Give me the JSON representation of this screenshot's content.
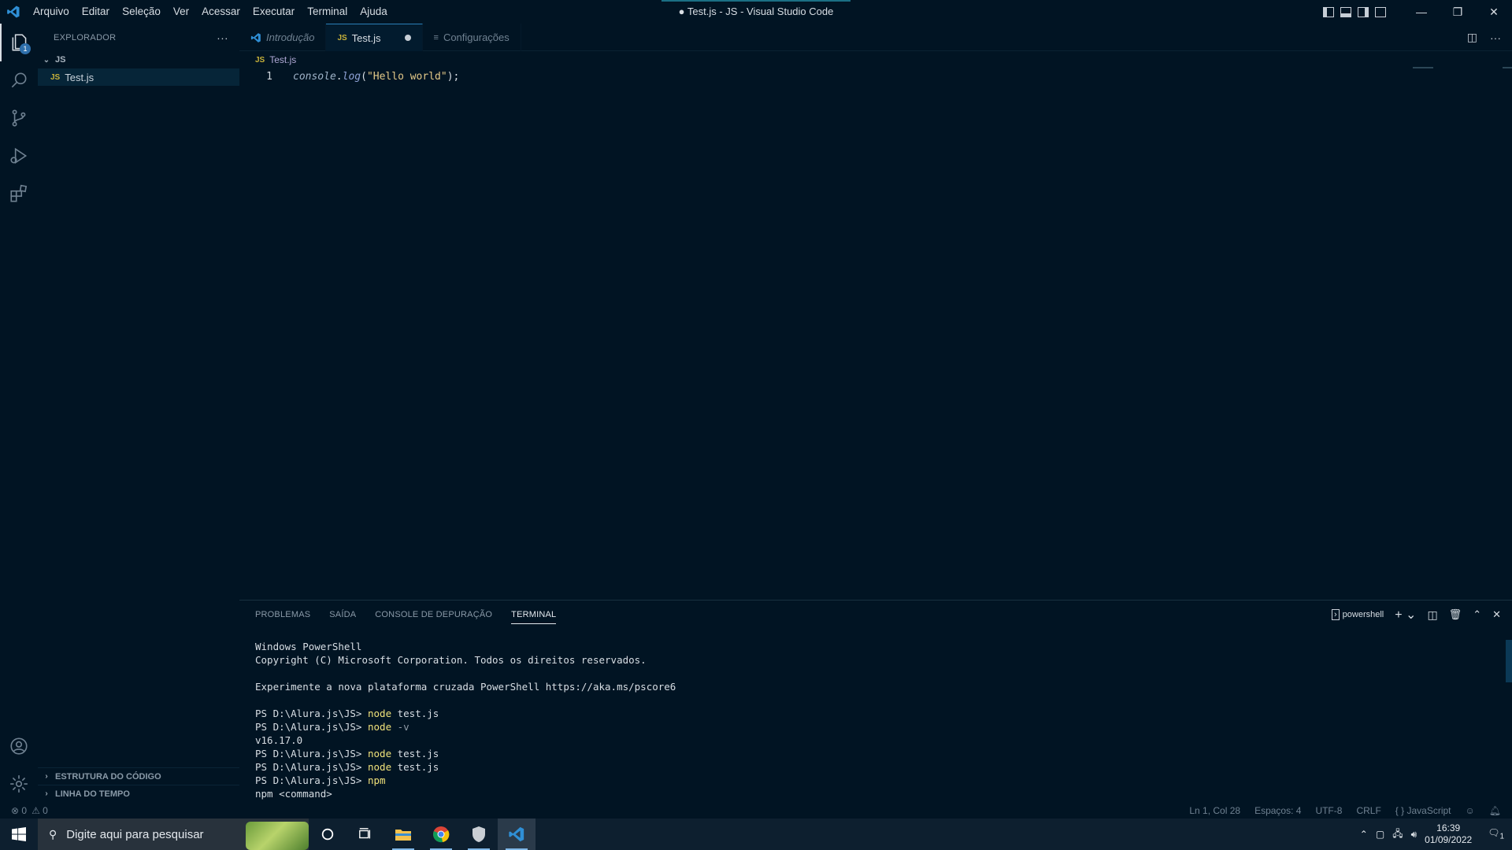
{
  "menu": [
    "Arquivo",
    "Editar",
    "Seleção",
    "Ver",
    "Acessar",
    "Executar",
    "Terminal",
    "Ajuda"
  ],
  "window_title": "● Test.js - JS - Visual Studio Code",
  "window_controls": {
    "minimize": "—",
    "restore": "❐",
    "close": "✕"
  },
  "activity": {
    "explorer_badge": "1"
  },
  "sidebar": {
    "header": "EXPLORADOR",
    "more": "···",
    "folder": "JS",
    "file": "Test.js",
    "file_icon": "JS",
    "outline": "ESTRUTURA DO CÓDIGO",
    "timeline": "LINHA DO TEMPO"
  },
  "tabs": [
    {
      "label": "Introdução"
    },
    {
      "label": "Test.js",
      "icon": "JS"
    },
    {
      "label": "Configurações"
    }
  ],
  "breadcrumb": "Test.js",
  "editor": {
    "line_number": "1",
    "tokens": {
      "obj": "console",
      "dot": ".",
      "fn": "log",
      "open": "(",
      "str": "\"Hello world\"",
      "close": ");"
    }
  },
  "panel": {
    "tabs": [
      "PROBLEMAS",
      "SAÍDA",
      "CONSOLE DE DEPURAÇÃO",
      "TERMINAL"
    ],
    "shell": "powershell",
    "terminal": {
      "l1": "Windows PowerShell",
      "l2": "Copyright (C) Microsoft Corporation. Todos os direitos reservados.",
      "l3": "Experimente a nova plataforma cruzada PowerShell https://aka.ms/pscore6",
      "prompt": "PS D:\\Alura.js\\JS> ",
      "c1": "node",
      "a1": " test.js",
      "c2": "node",
      "a2": " -v",
      "out2": "v16.17.0",
      "c3": "node",
      "a3": " test.js",
      "c4": "node",
      "a4": " test.js",
      "c5": "npm",
      "out5": "npm <command>"
    }
  },
  "status": {
    "errors": "⊗ 0",
    "warnings": "⚠ 0",
    "position": "Ln 1, Col 28",
    "spaces": "Espaços: 4",
    "encoding": "UTF-8",
    "eol": "CRLF",
    "language": "{ } JavaScript"
  },
  "taskbar": {
    "search_placeholder": "Digite aqui para pesquisar",
    "time": "16:39",
    "date": "01/09/2022",
    "notifications": "1"
  },
  "colors": {
    "background": "#011423",
    "accent": "#2a7fb7",
    "js_icon": "#c8b23a"
  }
}
